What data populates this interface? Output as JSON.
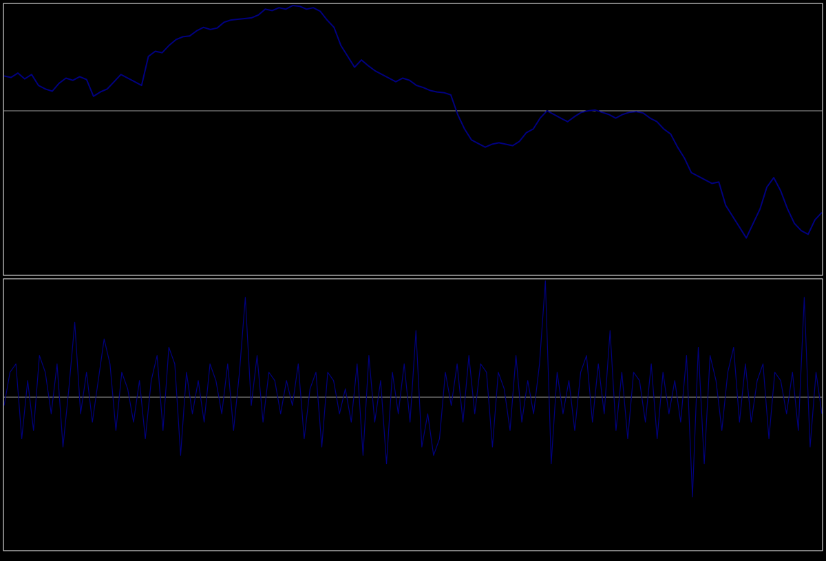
{
  "colors": {
    "background": "#000000",
    "frame": "#ffffff",
    "zero_line": "#a0a0a0",
    "series": "#000080"
  },
  "chart_data": [
    {
      "type": "line",
      "panel": "top",
      "grid": false,
      "axes_labeled": false,
      "reference_line": true,
      "series": [
        {
          "color": "#000080",
          "values": [
            0.48,
            0.46,
            0.52,
            0.44,
            0.5,
            0.35,
            0.3,
            0.27,
            0.38,
            0.45,
            0.42,
            0.47,
            0.43,
            0.2,
            0.26,
            0.3,
            0.4,
            0.5,
            0.45,
            0.4,
            0.35,
            0.75,
            0.82,
            0.8,
            0.9,
            0.98,
            1.02,
            1.03,
            1.1,
            1.15,
            1.12,
            1.14,
            1.22,
            1.25,
            1.26,
            1.27,
            1.28,
            1.32,
            1.4,
            1.38,
            1.42,
            1.4,
            1.45,
            1.44,
            1.4,
            1.42,
            1.37,
            1.25,
            1.15,
            0.9,
            0.75,
            0.6,
            0.7,
            0.62,
            0.55,
            0.5,
            0.45,
            0.4,
            0.45,
            0.42,
            0.35,
            0.32,
            0.28,
            0.26,
            0.25,
            0.22,
            -0.05,
            -0.25,
            -0.4,
            -0.45,
            -0.5,
            -0.46,
            -0.44,
            -0.46,
            -0.48,
            -0.42,
            -0.3,
            -0.25,
            -0.1,
            0.0,
            -0.05,
            -0.1,
            -0.15,
            -0.08,
            -0.02,
            0.0,
            0.01,
            -0.02,
            -0.05,
            -0.1,
            -0.05,
            -0.02,
            -0.01,
            -0.03,
            -0.1,
            -0.15,
            -0.25,
            -0.32,
            -0.5,
            -0.65,
            -0.85,
            -0.9,
            -0.95,
            -1.0,
            -0.98,
            -1.3,
            -1.45,
            -1.6,
            -1.75,
            -1.55,
            -1.35,
            -1.05,
            -0.92,
            -1.1,
            -1.35,
            -1.55,
            -1.65,
            -1.7,
            -1.5,
            -1.4
          ]
        }
      ]
    },
    {
      "type": "line",
      "panel": "bottom",
      "grid": false,
      "axes_labeled": false,
      "reference_line": true,
      "series": [
        {
          "color": "#000080",
          "values": [
            -0.1,
            0.3,
            0.4,
            -0.5,
            0.2,
            -0.4,
            0.5,
            0.3,
            -0.2,
            0.4,
            -0.6,
            0.1,
            0.9,
            -0.2,
            0.3,
            -0.3,
            0.2,
            0.7,
            0.4,
            -0.4,
            0.3,
            0.1,
            -0.3,
            0.2,
            -0.5,
            0.2,
            0.5,
            -0.4,
            0.6,
            0.4,
            -0.7,
            0.3,
            -0.2,
            0.2,
            -0.3,
            0.4,
            0.2,
            -0.2,
            0.4,
            -0.4,
            0.3,
            1.2,
            -0.1,
            0.5,
            -0.3,
            0.3,
            0.2,
            -0.2,
            0.2,
            -0.1,
            0.4,
            -0.5,
            0.1,
            0.3,
            -0.6,
            0.3,
            0.2,
            -0.2,
            0.1,
            -0.3,
            0.4,
            -0.7,
            0.5,
            -0.3,
            0.2,
            -0.8,
            0.3,
            -0.2,
            0.4,
            -0.3,
            0.8,
            -0.6,
            -0.2,
            -0.7,
            -0.5,
            0.3,
            -0.1,
            0.4,
            -0.3,
            0.5,
            -0.2,
            0.4,
            0.3,
            -0.6,
            0.3,
            0.1,
            -0.4,
            0.5,
            -0.3,
            0.2,
            -0.2,
            0.4,
            1.4,
            -0.8,
            0.3,
            -0.2,
            0.2,
            -0.4,
            0.3,
            0.5,
            -0.3,
            0.4,
            -0.2,
            0.8,
            -0.4,
            0.3,
            -0.5,
            0.3,
            0.2,
            -0.3,
            0.4,
            -0.5,
            0.3,
            -0.2,
            0.2,
            -0.3,
            0.5,
            -1.2,
            0.6,
            -0.8,
            0.5,
            0.2,
            -0.4,
            0.3,
            0.6,
            -0.3,
            0.4,
            -0.3,
            0.2,
            0.4,
            -0.5,
            0.3,
            0.2,
            -0.2,
            0.3,
            -0.4,
            1.2,
            -0.6,
            0.3,
            -0.2
          ]
        }
      ]
    }
  ]
}
